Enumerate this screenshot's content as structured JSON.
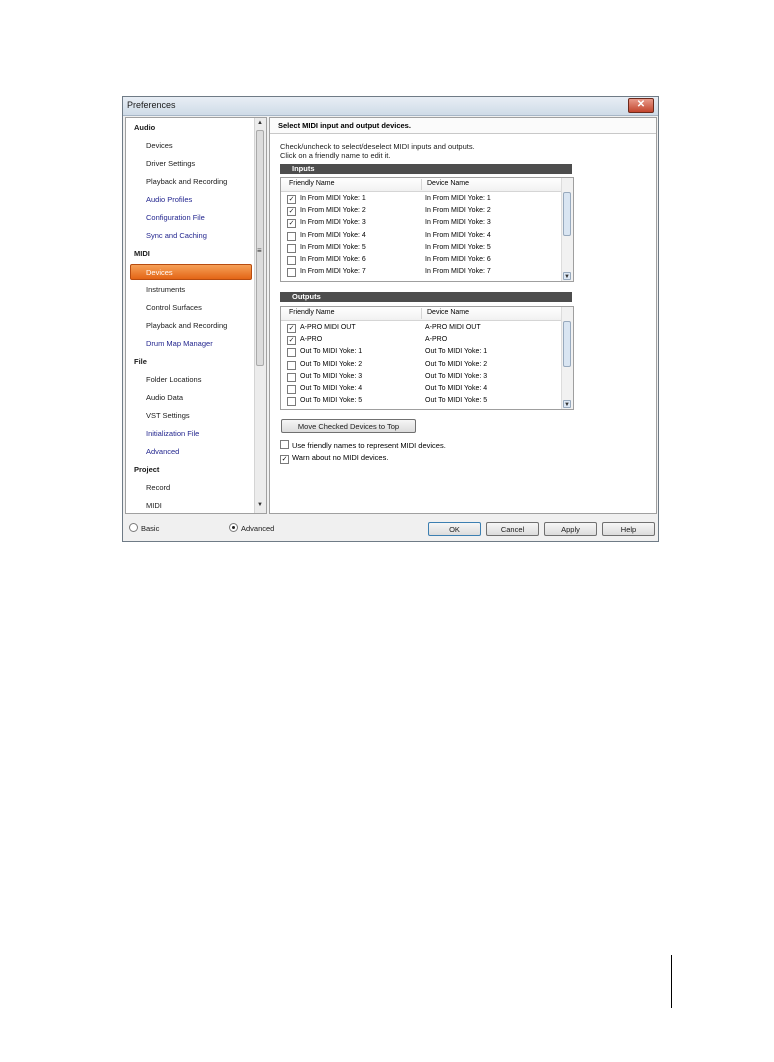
{
  "window": {
    "title": "Preferences",
    "close_glyph": "✕"
  },
  "sidebar": {
    "items": [
      {
        "label": "Audio",
        "kind": "cat"
      },
      {
        "label": "Devices",
        "kind": "sub"
      },
      {
        "label": "Driver Settings",
        "kind": "sub"
      },
      {
        "label": "Playback and Recording",
        "kind": "sub"
      },
      {
        "label": "Audio Profiles",
        "kind": "link"
      },
      {
        "label": "Configuration File",
        "kind": "link"
      },
      {
        "label": "Sync and Caching",
        "kind": "link"
      },
      {
        "label": "MIDI",
        "kind": "cat"
      },
      {
        "label": "Devices",
        "kind": "selected"
      },
      {
        "label": "Instruments",
        "kind": "sub"
      },
      {
        "label": "Control Surfaces",
        "kind": "sub"
      },
      {
        "label": "Playback and Recording",
        "kind": "sub"
      },
      {
        "label": "Drum Map Manager",
        "kind": "link"
      },
      {
        "label": "File",
        "kind": "cat"
      },
      {
        "label": "Folder Locations",
        "kind": "sub"
      },
      {
        "label": "Audio Data",
        "kind": "sub"
      },
      {
        "label": "VST Settings",
        "kind": "sub"
      },
      {
        "label": "Initialization File",
        "kind": "link"
      },
      {
        "label": "Advanced",
        "kind": "link"
      },
      {
        "label": "Project",
        "kind": "cat"
      },
      {
        "label": "Record",
        "kind": "sub"
      },
      {
        "label": "MIDI",
        "kind": "sub"
      }
    ]
  },
  "panel": {
    "heading": "Select MIDI input and output devices.",
    "instr_line1": "Check/uncheck to select/deselect MIDI inputs and outputs.",
    "instr_line2": "Click on a friendly name to edit it.",
    "inputs": {
      "title": "Inputs",
      "col_friendly": "Friendly Name",
      "col_device": "Device Name",
      "rows": [
        {
          "friendly": "In From MIDI Yoke:  1",
          "device": "In From MIDI Yoke:  1",
          "checked": true
        },
        {
          "friendly": "In From MIDI Yoke:  2",
          "device": "In From MIDI Yoke:  2",
          "checked": true
        },
        {
          "friendly": "In From MIDI Yoke:  3",
          "device": "In From MIDI Yoke:  3",
          "checked": true
        },
        {
          "friendly": "In From MIDI Yoke:  4",
          "device": "In From MIDI Yoke:  4",
          "checked": false
        },
        {
          "friendly": "In From MIDI Yoke:  5",
          "device": "In From MIDI Yoke:  5",
          "checked": false
        },
        {
          "friendly": "In From MIDI Yoke:  6",
          "device": "In From MIDI Yoke:  6",
          "checked": false
        },
        {
          "friendly": "In From MIDI Yoke:  7",
          "device": "In From MIDI Yoke:  7",
          "checked": false
        }
      ]
    },
    "outputs": {
      "title": "Outputs",
      "col_friendly": "Friendly Name",
      "col_device": "Device Name",
      "rows": [
        {
          "friendly": "A-PRO MIDI OUT",
          "device": "A-PRO MIDI OUT",
          "checked": true
        },
        {
          "friendly": "A-PRO",
          "device": "A-PRO",
          "checked": true
        },
        {
          "friendly": "Out To MIDI Yoke:  1",
          "device": "Out To MIDI Yoke:  1",
          "checked": false
        },
        {
          "friendly": "Out To MIDI Yoke:  2",
          "device": "Out To MIDI Yoke:  2",
          "checked": false
        },
        {
          "friendly": "Out To MIDI Yoke:  3",
          "device": "Out To MIDI Yoke:  3",
          "checked": false
        },
        {
          "friendly": "Out To MIDI Yoke:  4",
          "device": "Out To MIDI Yoke:  4",
          "checked": false
        },
        {
          "friendly": "Out To MIDI Yoke:  5",
          "device": "Out To MIDI Yoke:  5",
          "checked": false
        }
      ]
    },
    "move_button": "Move Checked Devices to Top",
    "opt_friendly": {
      "label": "Use friendly names to represent MIDI devices.",
      "checked": false
    },
    "opt_warn": {
      "label": "Warn about no MIDI devices.",
      "checked": true
    }
  },
  "footer": {
    "basic": "Basic",
    "advanced": "Advanced",
    "mode": "advanced",
    "ok": "OK",
    "cancel": "Cancel",
    "apply": "Apply",
    "help": "Help"
  },
  "glyphs": {
    "check": "✓",
    "up": "▲",
    "down": "▼",
    "grip": "≡"
  },
  "colors": {
    "selected_item": "#e46516",
    "link_text": "#23268f",
    "section_bar": "#4d4d4d"
  }
}
